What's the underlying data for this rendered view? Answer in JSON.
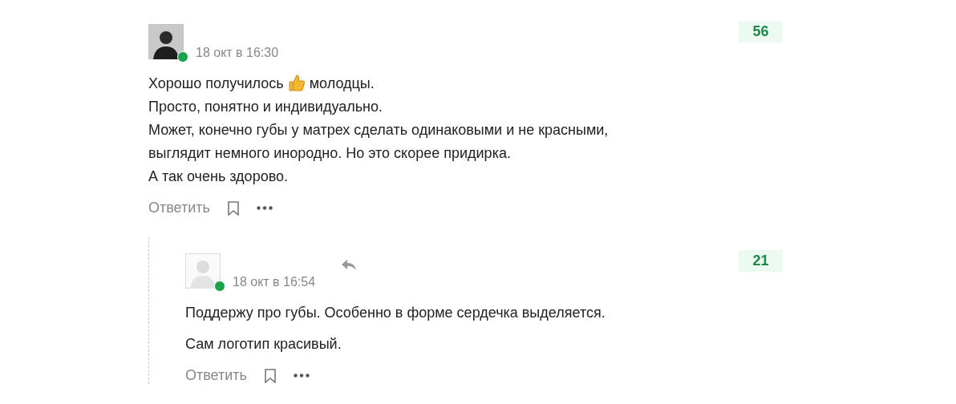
{
  "comments": [
    {
      "time": "18 окт в 16:30",
      "online": true,
      "score": "56",
      "reply_marker": false,
      "paragraphs": [
        {
          "lines": [
            {
              "text": "Хорошо получилось",
              "emoji": true,
              "after": "молодцы."
            },
            {
              "text": "Просто, понятно и индивидуально."
            },
            {
              "text": "Может, конечно губы у матрех сделать одинаковыми и не красными,"
            },
            {
              "text": "выглядит немного инородно. Но это скорее придирка."
            },
            {
              "text": "А так очень здорово."
            }
          ]
        }
      ],
      "reply_label": "Ответить",
      "children": [
        {
          "time": "18 окт в 16:54",
          "online": true,
          "score": "21",
          "reply_marker": true,
          "paragraphs": [
            {
              "lines": [
                {
                  "text": "Поддержу про губы. Особенно в форме сердечка выделяется."
                }
              ]
            },
            {
              "lines": [
                {
                  "text": "Сам логотип красивый."
                }
              ]
            }
          ],
          "reply_label": "Ответить"
        }
      ]
    }
  ]
}
